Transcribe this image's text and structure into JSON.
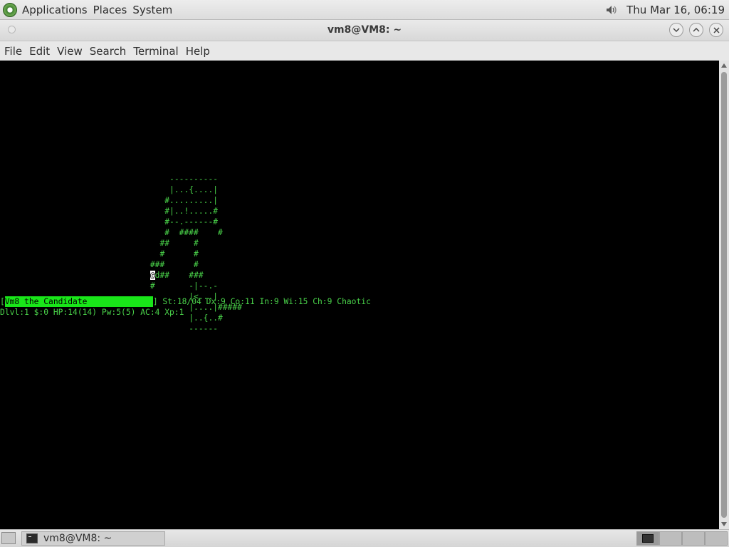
{
  "top_panel": {
    "menus": [
      "Applications",
      "Places",
      "System"
    ],
    "clock": "Thu Mar 16, 06:19"
  },
  "window": {
    "title": "vm8@VM8: ~",
    "menubar": [
      "File",
      "Edit",
      "View",
      "Search",
      "Terminal",
      "Help"
    ]
  },
  "terminal": {
    "map_lines": [
      "                                   ----------",
      "                                   |...{....|",
      "                                  #.........|",
      "                                  #|..!.....#",
      "                                  #--.------#",
      "                                  #  ####    #",
      "                                 ##     #",
      "                                 #      #",
      "                               ###      #",
      "                               ",
      "                               #       -|--.-",
      "                                       |<...|",
      "                                       |....|#####",
      "                                       |..{..#",
      "                                       ------"
    ],
    "cursor_line": {
      "prefix": "                               ",
      "cursor": "@",
      "rest": "d##    ###"
    },
    "status": {
      "bracket_open": "[",
      "name": "Vm8 the Candidate",
      "stats": "] St:18/04 Dx:9 Co:11 In:9 Wi:15 Ch:9 Chaotic",
      "line2": "Dlvl:1 $:0 HP:14(14) Pw:5(5) AC:4 Xp:1"
    }
  },
  "taskbar": {
    "task_label": "vm8@VM8: ~"
  },
  "colors": {
    "terminal_fg": "#4ad34a",
    "name_highlight": "#19e619"
  }
}
